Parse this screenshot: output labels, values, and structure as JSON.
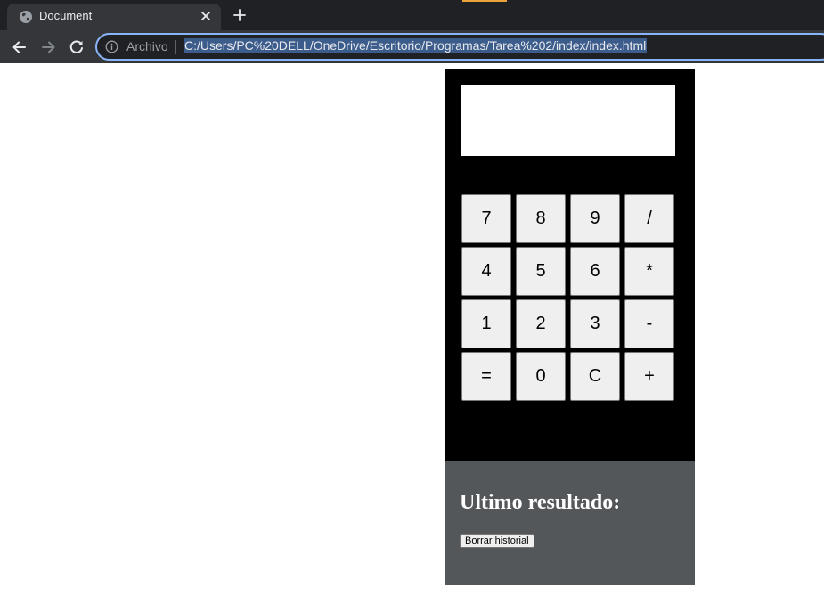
{
  "browser": {
    "tab_title": "Document",
    "url_scheme_label": "Archivo",
    "url": "C:/Users/PC%20DELL/OneDrive/Escritorio/Programas/Tarea%202/index/index.html"
  },
  "calculator": {
    "display_value": "",
    "keys": [
      "7",
      "8",
      "9",
      "/",
      "4",
      "5",
      "6",
      "*",
      "1",
      "2",
      "3",
      "-",
      "=",
      "0",
      "C",
      "+"
    ]
  },
  "history": {
    "heading": "Ultimo resultado:",
    "clear_label": "Borrar historial"
  },
  "colors": {
    "calculator_bg": "#000000",
    "history_bg": "#54575a",
    "key_bg": "#efefef",
    "browser_frame": "#202124",
    "omnibox_focus": "#8ab4f8"
  }
}
